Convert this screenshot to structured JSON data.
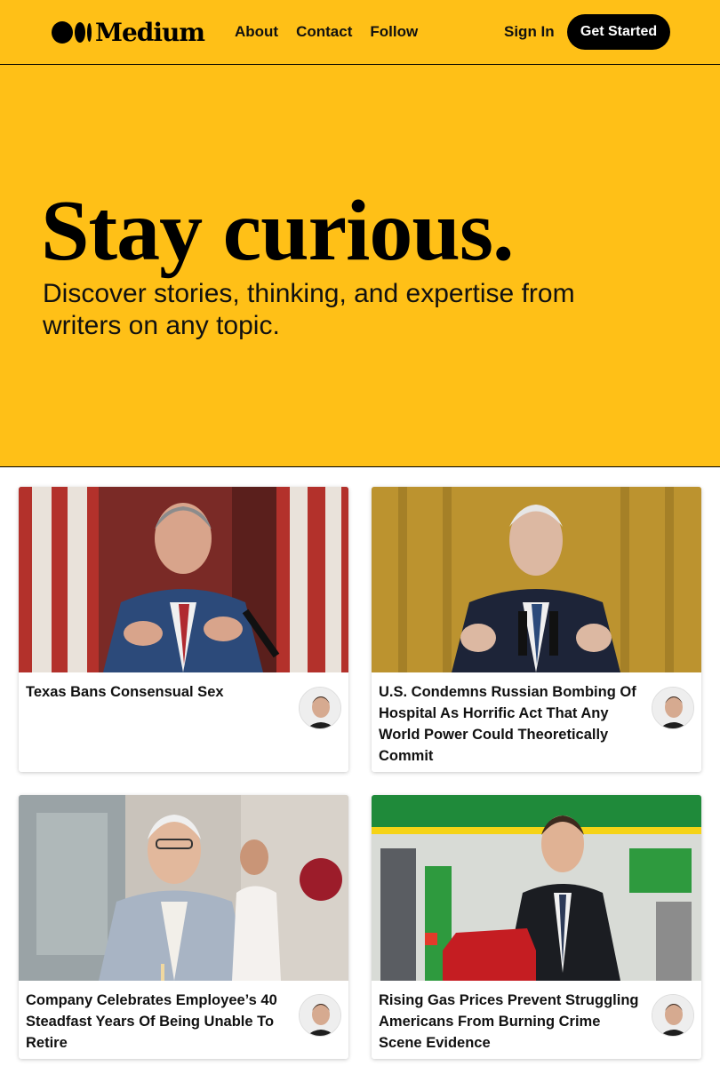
{
  "header": {
    "logo_text": "Medium",
    "nav": [
      "About",
      "Contact",
      "Follow"
    ],
    "sign_in": "Sign In",
    "get_started": "Get Started"
  },
  "hero": {
    "title": "Stay curious.",
    "subtitle": "Discover stories, thinking, and expertise from writers on any topic."
  },
  "articles": [
    {
      "title": "Texas Bans Consensual Sex"
    },
    {
      "title": "U.S. Condemns Russian Bombing Of Hospital As Horrific Act That Any World Power Could Theoretically Commit"
    },
    {
      "title": "Company Celebrates Employee’s 40 Steadfast Years Of Being Unable To Retire"
    },
    {
      "title": "Rising Gas Prices Prevent Struggling Americans From Burning Crime Scene Evidence"
    }
  ],
  "colors": {
    "brand_yellow": "#ffc017",
    "button_black": "#000000"
  }
}
